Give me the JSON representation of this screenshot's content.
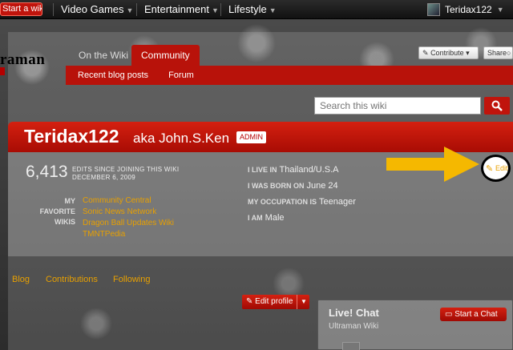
{
  "global_nav": {
    "start_wiki": "Start a wiki",
    "hubs": [
      "Video Games",
      "Entertainment",
      "Lifestyle"
    ],
    "username": "Teridax122"
  },
  "wiki": {
    "logo_text": "raman",
    "tabs": {
      "on_the_wiki": "On the Wiki",
      "community": "Community"
    },
    "subnav": [
      "Recent blog posts",
      "Forum"
    ],
    "contribute": "Contribute",
    "share": "Share",
    "search_placeholder": "Search this wiki"
  },
  "profile": {
    "name": "Teridax122",
    "aka_prefix": "aka",
    "real_name": "John.S.Ken",
    "badge": "ADMIN",
    "edit_count": "6,413",
    "edits_label": "EDITS SINCE JOINING THIS WIKI",
    "joined_date": "DECEMBER 6, 2009",
    "favorite_label": "MY FAVORITE WIKIS",
    "favorite_wikis": [
      "Community Central",
      "Sonic News Network",
      "Dragon Ball Updates Wiki",
      "TMNTPedia"
    ],
    "info": [
      {
        "key": "I LIVE IN",
        "value": "Thailand/U.S.A"
      },
      {
        "key": "I WAS BORN ON",
        "value": "June 24"
      },
      {
        "key": "MY OCCUPATION IS",
        "value": "Teenager"
      },
      {
        "key": "I AM",
        "value": "Male"
      }
    ],
    "edit_link": "Edit",
    "tabs": [
      "Blog",
      "Contributions",
      "Following"
    ],
    "edit_profile": "Edit profile"
  },
  "chat": {
    "title": "Live! Chat",
    "subtitle": "Ultraman Wiki",
    "start_chat": "Start a Chat"
  },
  "colors": {
    "accent_red": "#b8120a",
    "link_orange": "#e8a000",
    "annotation_arrow": "#f5b800"
  }
}
